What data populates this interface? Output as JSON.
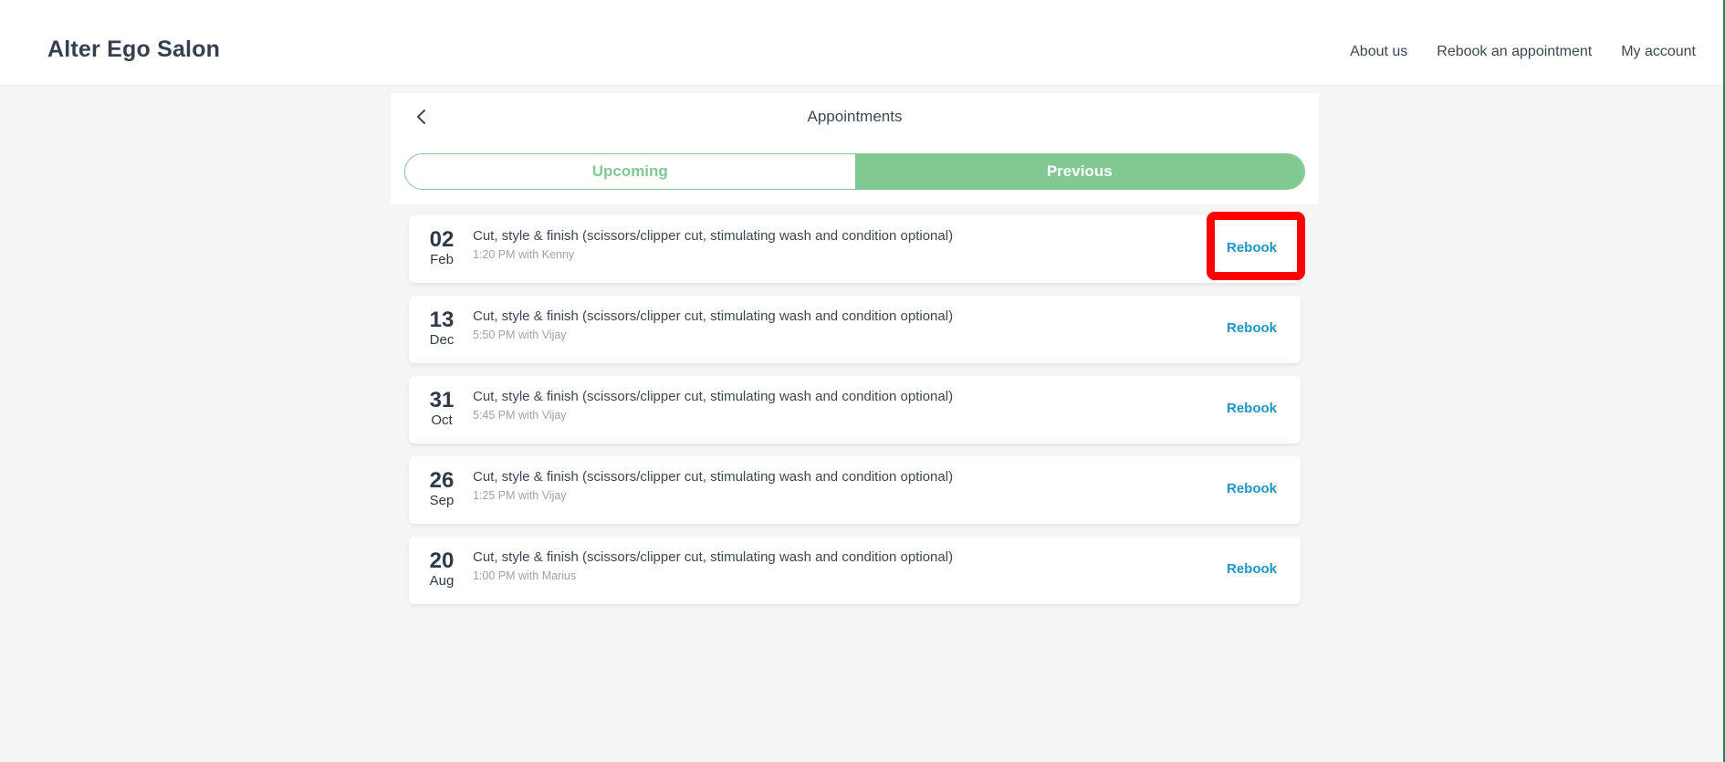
{
  "header": {
    "brand": "Alter Ego Salon",
    "nav": [
      "About us",
      "Rebook an appointment",
      "My account"
    ]
  },
  "panel": {
    "title": "Appointments",
    "back_icon": "chevron-left-icon"
  },
  "tabs": [
    {
      "label": "Upcoming",
      "active": false
    },
    {
      "label": "Previous",
      "active": true
    }
  ],
  "appointments": [
    {
      "day": "02",
      "month": "Feb",
      "service": "Cut, style & finish (scissors/clipper cut, stimulating wash and condition optional)",
      "meta": "1:20 PM with Kenny",
      "action": "Rebook"
    },
    {
      "day": "13",
      "month": "Dec",
      "service": "Cut, style & finish (scissors/clipper cut, stimulating wash and condition optional)",
      "meta": "5:50 PM with Vijay",
      "action": "Rebook"
    },
    {
      "day": "31",
      "month": "Oct",
      "service": "Cut, style & finish (scissors/clipper cut, stimulating wash and condition optional)",
      "meta": "5:45 PM with Vijay",
      "action": "Rebook"
    },
    {
      "day": "26",
      "month": "Sep",
      "service": "Cut, style & finish (scissors/clipper cut, stimulating wash and condition optional)",
      "meta": "1:25 PM with Vijay",
      "action": "Rebook"
    },
    {
      "day": "20",
      "month": "Aug",
      "service": "Cut, style & finish (scissors/clipper cut, stimulating wash and condition optional)",
      "meta": "1:00 PM with Marius",
      "action": "Rebook"
    }
  ],
  "colors": {
    "accent_green": "#82c893",
    "link_blue": "#1a97c8",
    "highlight_red": "#ff0000"
  }
}
